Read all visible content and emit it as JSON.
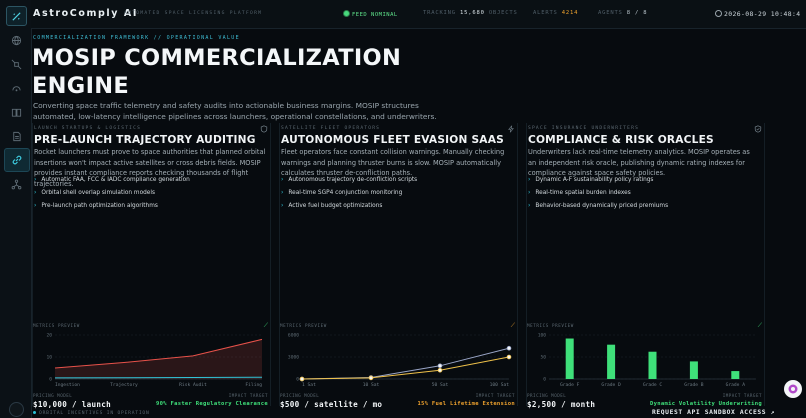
{
  "app": {
    "name": "AstroComply AI",
    "subtitle": "AUTOMATED SPACE LICENSING PLATFORM"
  },
  "status": {
    "feed": "FEED NOMINAL",
    "tracking_label": "TRACKING",
    "tracking_value": "15,680",
    "tracking_unit": "OBJECTS",
    "alerts_label": "ALERTS",
    "alerts_value": "4214",
    "agents_label": "AGENTS",
    "agents_value": "8 / 8",
    "clock": "2026-08-29 10:48:4"
  },
  "colors": {
    "accent": "#30c4d8",
    "green": "#3fe07a",
    "orange": "#f0a32e",
    "red": "#e8524a",
    "background": "#070b0f"
  },
  "rail_icons": [
    "logo-icon",
    "globe-icon",
    "satellite-icon",
    "radar-icon",
    "book-icon",
    "document-icon",
    "link-icon",
    "network-icon",
    "user-icon"
  ],
  "hero": {
    "kicker": "COMMERCIALIZATION FRAMEWORK // OPERATIONAL VALUE",
    "title": "MOSIP COMMERCIALIZATION ENGINE",
    "lead": "Converting space traffic telemetry and safety audits into actionable business margins. MOSIP structures automated, low-latency intelligence pipelines across launchers, operational constellations, and underwriters."
  },
  "cards": [
    {
      "eyebrow": "LAUNCH STARTUPS & LOGISTICS",
      "title": "PRE-LAUNCH TRAJECTORY AUDITING",
      "desc": "Rocket launchers must prove to space authorities that planned orbital insertions won't impact active satellites or cross debris fields. MOSIP provides instant compliance reports checking thousands of flight trajectories.",
      "features": [
        "Automatic FAA, FCC & IADC compliance generation",
        "Orbital shell overlap simulation models",
        "Pre-launch path optimization algorithms"
      ],
      "metrics_label": "METRICS PREVIEW",
      "pricing_label": "PRICING MODEL",
      "impact_label": "IMPACT TARGET",
      "price": "$10,000 / launch",
      "impact": "90% Faster Regulatory Clearance"
    },
    {
      "eyebrow": "SATELLITE FLEET OPERATORS",
      "title": "AUTONOMOUS FLEET EVASION SAAS",
      "desc": "Fleet operators face constant collision warnings. Manually checking warnings and planning thruster burns is slow. MOSIP automatically calculates thruster de-confliction paths.",
      "features": [
        "Autonomous trajectory de-confliction scripts",
        "Real-time SGP4 conjunction monitoring",
        "Active fuel budget optimizations"
      ],
      "metrics_label": "METRICS PREVIEW",
      "pricing_label": "PRICING MODEL",
      "impact_label": "IMPACT TARGET",
      "price": "$500 / satellite / mo",
      "impact": "15% Fuel Lifetime Extension"
    },
    {
      "eyebrow": "SPACE INSURANCE UNDERWRITERS",
      "title": "COMPLIANCE & RISK ORACLES",
      "desc": "Underwriters lack real-time telemetry analytics. MOSIP operates as an independent risk oracle, publishing dynamic rating indexes for compliance against space safety policies.",
      "features": [
        "Dynamic A-F sustainability policy ratings",
        "Real-time spatial burden indexes",
        "Behavior-based dynamically priced premiums"
      ],
      "metrics_label": "METRICS PREVIEW",
      "pricing_label": "PRICING MODEL",
      "impact_label": "IMPACT TARGET",
      "price": "$2,500 / month",
      "impact": "Dynamic Volatility Underwriting"
    }
  ],
  "chart_data": [
    {
      "type": "area",
      "categories": [
        "Ingestion",
        "Trajectory",
        "Risk Audit",
        "Filing"
      ],
      "ylim": [
        0,
        20
      ],
      "yticks": [
        0,
        10,
        20
      ],
      "series": [
        {
          "color": "#e8524a",
          "values": [
            5,
            7.5,
            10.5,
            18
          ]
        },
        {
          "color": "#30c4d8",
          "values": [
            0.5,
            0.6,
            0.7,
            0.8
          ]
        }
      ]
    },
    {
      "type": "line",
      "categories": [
        "1 Sat",
        "10 Sat",
        "50 Sat",
        "100 Sat"
      ],
      "ylim": [
        0,
        6000
      ],
      "yticks": [
        0,
        3000,
        6000
      ],
      "series": [
        {
          "color": "#9aa6c8",
          "values": [
            0,
            200,
            1800,
            4200
          ]
        },
        {
          "color": "#f0c24a",
          "values": [
            0,
            150,
            1200,
            3000
          ]
        }
      ]
    },
    {
      "type": "bar",
      "categories": [
        "Grade F",
        "Grade D",
        "Grade C",
        "Grade B",
        "Grade A"
      ],
      "ylim": [
        0,
        100
      ],
      "yticks": [
        0,
        50,
        100
      ],
      "values": [
        92,
        78,
        62,
        40,
        18
      ],
      "color": "#3fe07a"
    }
  ],
  "footer": {
    "orbital": "ORBITAL INCENTIVES IN OPERATION",
    "api_button": "REQUEST API SANDBOX ACCESS ↗"
  }
}
